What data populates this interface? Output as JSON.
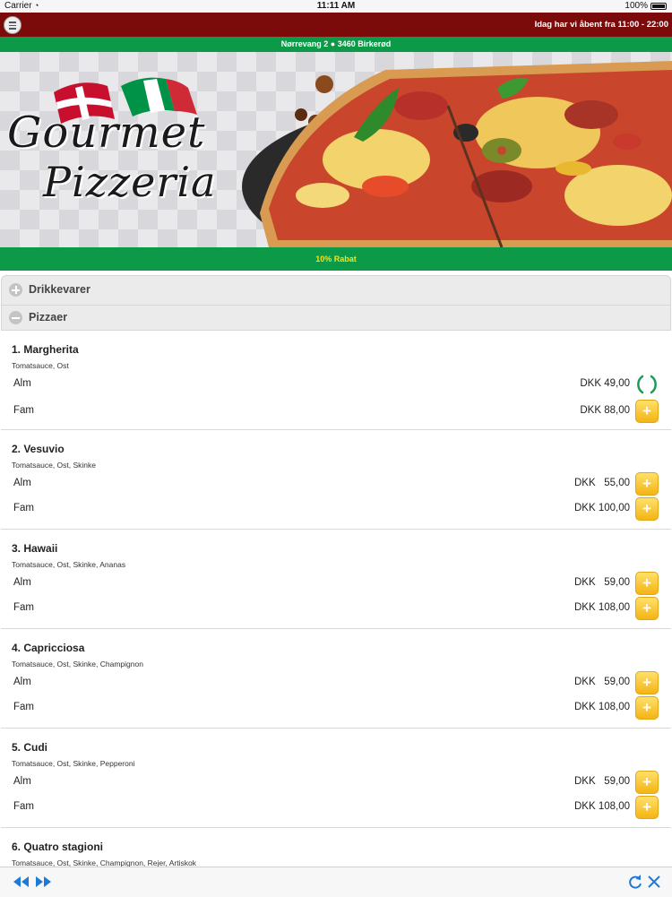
{
  "status_bar": {
    "carrier": "Carrier",
    "time": "11:11 AM",
    "battery": "100%"
  },
  "header": {
    "menu_icon": "hamburger-menu-icon",
    "hours": "Idag har vi åbent fra 11:00 - 22:00",
    "address": "Nørrevang 2 ● 3460 Birkerød",
    "color_top": "#7b0a0a",
    "color_green": "#0c9a49"
  },
  "banner": {
    "logo_line1": "Gourmet",
    "logo_line2": "Pizzeria"
  },
  "promo": {
    "text": "10% Rabat",
    "color": "#f6e21a"
  },
  "categories": [
    {
      "title": "Drikkevarer",
      "state": "collapsed"
    },
    {
      "title": "Pizzaer",
      "state": "expanded"
    }
  ],
  "pizzas": [
    {
      "name": "1. Margherita",
      "desc": "Tomatsauce, Ost",
      "options": [
        {
          "size": "Alm",
          "price": "DKK 49,00",
          "state": "loading"
        },
        {
          "size": "Fam",
          "price": "DKK 88,00"
        }
      ]
    },
    {
      "name": "2. Vesuvio",
      "desc": "Tomatsauce, Ost, Skinke",
      "options": [
        {
          "size": "Alm",
          "price": "DKK   55,00"
        },
        {
          "size": "Fam",
          "price": "DKK 100,00"
        }
      ]
    },
    {
      "name": "3. Hawaii",
      "desc": "Tomatsauce, Ost, Skinke, Ananas",
      "options": [
        {
          "size": "Alm",
          "price": "DKK   59,00"
        },
        {
          "size": "Fam",
          "price": "DKK 108,00"
        }
      ]
    },
    {
      "name": "4. Capricciosa",
      "desc": "Tomatsauce, Ost, Skinke, Champignon",
      "options": [
        {
          "size": "Alm",
          "price": "DKK   59,00"
        },
        {
          "size": "Fam",
          "price": "DKK 108,00"
        }
      ]
    },
    {
      "name": "5. Cudi",
      "desc": "Tomatsauce, Ost, Skinke, Pepperoni",
      "options": [
        {
          "size": "Alm",
          "price": "DKK   59,00"
        },
        {
          "size": "Fam",
          "price": "DKK 108,00"
        }
      ]
    },
    {
      "name": "6. Quatro stagioni",
      "desc": "Tomatsauce, Ost, Skinke, Champignon, Rejer, Artiskok",
      "options": []
    }
  ],
  "add_button": {
    "label": "+",
    "icon": "plus-icon"
  },
  "toolbar": {
    "icons": [
      "rewind-icon",
      "fast-forward-icon",
      "refresh-icon",
      "close-icon"
    ],
    "accent": "#1e7ad6"
  }
}
